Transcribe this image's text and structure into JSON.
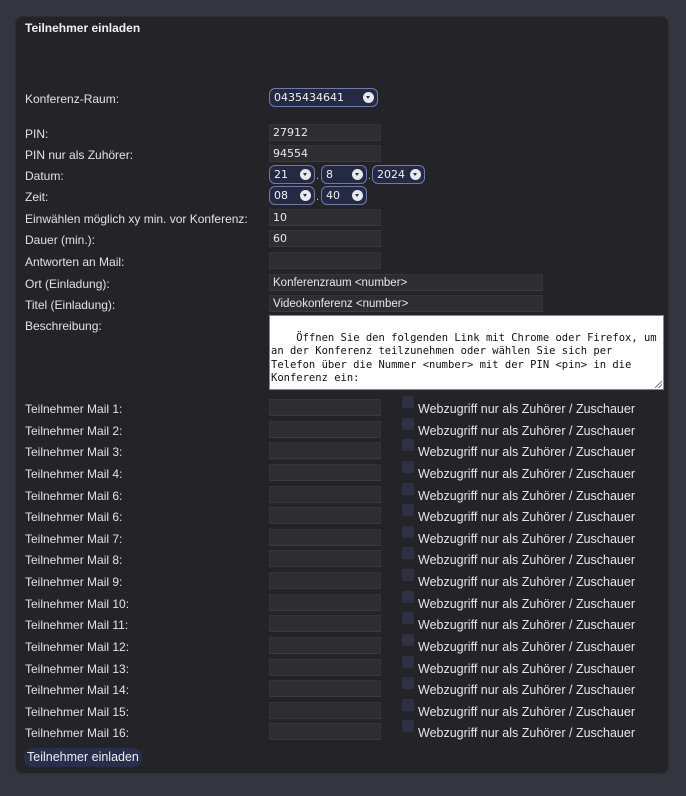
{
  "title": "Teilnehmer einladen",
  "room": {
    "label": "Konferenz-Raum:",
    "value": "0435434641"
  },
  "pin": {
    "label": "PIN:",
    "value": "27912"
  },
  "pin_listener": {
    "label": "PIN nur als Zuhörer:",
    "value": "94554"
  },
  "date": {
    "label": "Datum:",
    "day": "21",
    "month": "8",
    "year": "2024",
    "sep": "."
  },
  "time": {
    "label": "Zeit:",
    "hour": "08",
    "minute": "40",
    "sep": "."
  },
  "dialin": {
    "label": "Einwählen möglich xy min. vor Konferenz:",
    "value": "10"
  },
  "duration": {
    "label": "Dauer (min.):",
    "value": "60"
  },
  "reply": {
    "label": "Antworten an Mail:",
    "value": ""
  },
  "location": {
    "label": "Ort (Einladung):",
    "value": "Konferenzraum <number>"
  },
  "subject": {
    "label": "Titel (Einladung):",
    "value": "Videokonferenz <number>"
  },
  "description": {
    "label": "Beschreibung:",
    "value": "Öffnen Sie den folgenden Link mit Chrome oder Firefox, um an der Konferenz teilzunehmen oder wählen Sie sich per Telefon über die Nummer <number> mit der PIN <pin> in die Konferenz ein:"
  },
  "participants": [
    {
      "label": "Teilnehmer Mail 1:",
      "value": "",
      "check_label": "Webzugriff nur als Zuhörer / Zuschauer"
    },
    {
      "label": "Teilnehmer Mail 2:",
      "value": "",
      "check_label": "Webzugriff nur als Zuhörer / Zuschauer"
    },
    {
      "label": "Teilnehmer Mail 3:",
      "value": "",
      "check_label": "Webzugriff nur als Zuhörer / Zuschauer"
    },
    {
      "label": "Teilnehmer Mail 4:",
      "value": "",
      "check_label": "Webzugriff nur als Zuhörer / Zuschauer"
    },
    {
      "label": "Teilnehmer Mail 6:",
      "value": "",
      "check_label": "Webzugriff nur als Zuhörer / Zuschauer"
    },
    {
      "label": "Teilnehmer Mail 6:",
      "value": "",
      "check_label": "Webzugriff nur als Zuhörer / Zuschauer"
    },
    {
      "label": "Teilnehmer Mail 7:",
      "value": "",
      "check_label": "Webzugriff nur als Zuhörer / Zuschauer"
    },
    {
      "label": "Teilnehmer Mail 8:",
      "value": "",
      "check_label": "Webzugriff nur als Zuhörer / Zuschauer"
    },
    {
      "label": "Teilnehmer Mail 9:",
      "value": "",
      "check_label": "Webzugriff nur als Zuhörer / Zuschauer"
    },
    {
      "label": "Teilnehmer Mail 10:",
      "value": "",
      "check_label": "Webzugriff nur als Zuhörer / Zuschauer"
    },
    {
      "label": "Teilnehmer Mail 11:",
      "value": "",
      "check_label": "Webzugriff nur als Zuhörer / Zuschauer"
    },
    {
      "label": "Teilnehmer Mail 12:",
      "value": "",
      "check_label": "Webzugriff nur als Zuhörer / Zuschauer"
    },
    {
      "label": "Teilnehmer Mail 13:",
      "value": "",
      "check_label": "Webzugriff nur als Zuhörer / Zuschauer"
    },
    {
      "label": "Teilnehmer Mail 14:",
      "value": "",
      "check_label": "Webzugriff nur als Zuhörer / Zuschauer"
    },
    {
      "label": "Teilnehmer Mail 15:",
      "value": "",
      "check_label": "Webzugriff nur als Zuhörer / Zuschauer"
    },
    {
      "label": "Teilnehmer Mail 16:",
      "value": "",
      "check_label": "Webzugriff nur als Zuhörer / Zuschauer"
    }
  ],
  "submit_label": "Teilnehmer einladen"
}
